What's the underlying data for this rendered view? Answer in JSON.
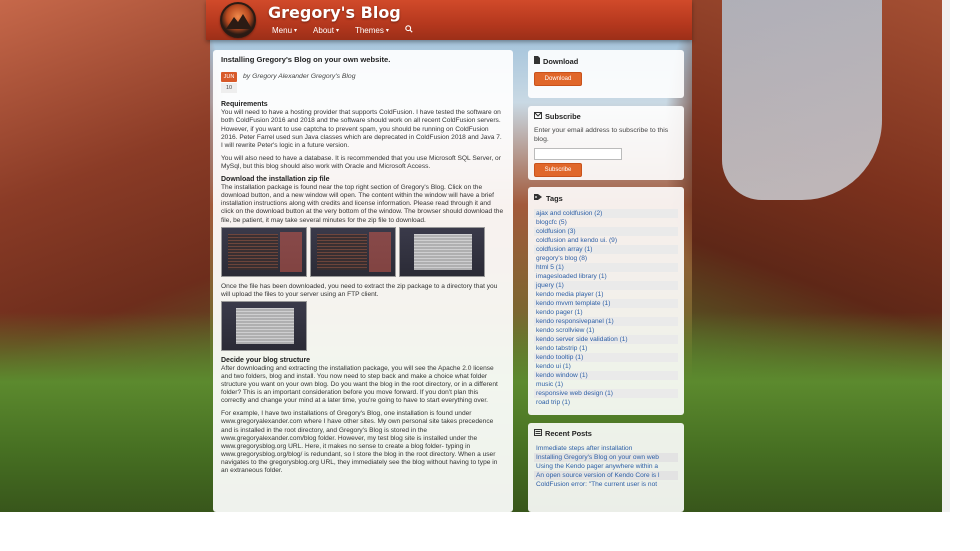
{
  "site": {
    "title": "Gregory's Blog",
    "nav": [
      {
        "label": "Menu",
        "caret": "▾"
      },
      {
        "label": "About",
        "caret": "▾"
      },
      {
        "label": "Themes",
        "caret": "▾"
      }
    ],
    "search_icon": "search-icon"
  },
  "post": {
    "title": "Installing Gregory's Blog on your own website.",
    "date_month": "JUN",
    "date_day": "10",
    "byline": "by Gregory Alexander Gregory's Blog",
    "sections": {
      "requirements_heading": "Requirements",
      "requirements_p1": "You will need to have a hosting provider that supports ColdFusion. I have tested the software on both ColdFusion 2016 and 2018 and the software should work on all recent ColdFusion servers. However, if you want to use captcha to prevent spam, you should be running on ColdFusion 2016. Peter Farrel used sun Java classes which are deprecated in ColdFusion 2018 and Java 7. I will rewrite Peter's logic in a future version.",
      "requirements_p2": "You will also need to have a database. It is recommended that you use Microsoft SQL Server, or MySql, but this blog should also work with Oracle and Microsoft Access.",
      "download_heading": "Download the installation zip file",
      "download_p": "The installation package is found near the top right section of Gregory's Blog. Click on the download button, and a new window will open. The content within the window will have a brief installation instructions along with credits and license information. Please read through it and click on the download button at the very bottom of the window. The browser should download the file, be patient, it may take several minutes for the zip file to download.",
      "extract_p": "Once the file has been downloaded, you need to extract the zip package to a directory that you will upload the files to your server using an FTP client.",
      "structure_heading": "Decide your blog structure",
      "structure_p1": "After downloading and extracting the installation package, you will see the Apache 2.0 license and two folders, blog and install. You now need to step back and make a choice what folder structure you want on your own blog. Do you want the blog in the root directory, or in a different folder? This is an important consideration before you move forward. If you don't plan this correctly and change your mind at a later time, you're going to have to start everything over.",
      "structure_p2": "For example, I have two installations of Gregory's Blog, one installation is found under www.gregoryalexander.com where I have other sites. My own personal site takes precedence and is installed in the root directory, and Gregory's Blog is stored in the www.gregoryalexander.com/blog folder. However, my test blog site is installed under the www.gregorysblog.org URL. Here, it makes no sense to create a blog folder- typing in www.gregorysblog.org/blog/ is redundant, so I store the blog in the root directory. When a user navigates to the gregorysblog.org URL, they immediately see the blog without having to type in an extraneous folder."
    }
  },
  "sidebar": {
    "download": {
      "title": "Download",
      "icon": "file-icon",
      "button": "Download"
    },
    "subscribe": {
      "title": "Subscribe",
      "icon": "envelope-icon",
      "text": "Enter your email address to subscribe to this blog.",
      "input_value": "",
      "button": "Subscribe"
    },
    "tags": {
      "title": "Tags",
      "icon": "tag-icon",
      "items": [
        "ajax and coldfusion (2)",
        "blogcfc (5)",
        "coldfusion (3)",
        "coldfusion and kendo ui. (9)",
        "coldfusion array (1)",
        "gregory's blog (8)",
        "html 5 (1)",
        "imagesloaded library (1)",
        "jquery (1)",
        "kendo media player (1)",
        "kendo mvvm template (1)",
        "kendo pager (1)",
        "kendo responsivepanel (1)",
        "kendo scrollview (1)",
        "kendo server side validation (1)",
        "kendo tabstrip (1)",
        "kendo tooltip (1)",
        "kendo ui (1)",
        "kendo window (1)",
        "music (1)",
        "responsive web design (1)",
        "road trip (1)"
      ]
    },
    "recent": {
      "title": "Recent Posts",
      "icon": "list-icon",
      "items": [
        "Immediate steps after installation",
        "Installing Gregory's Blog on your own web",
        "Using the Kendo pager anywhere within a",
        "An open source version of Kendo Core is l",
        "ColdFusion error: \"The current user is not"
      ]
    }
  }
}
